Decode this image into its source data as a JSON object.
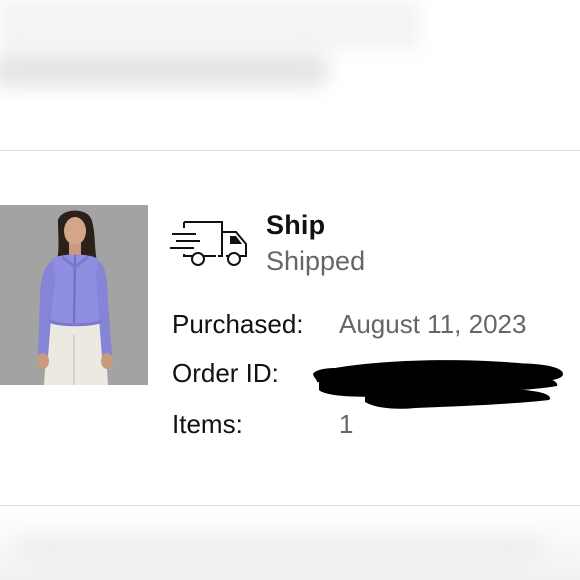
{
  "shipment": {
    "method": "Ship",
    "status": "Shipped"
  },
  "details": {
    "purchased_label": "Purchased:",
    "purchased_value": "August 11, 2023",
    "order_id_label": "Order ID:",
    "order_id_value": "",
    "items_label": "Items:",
    "items_value": "1"
  },
  "product": {
    "image_subject": "person wearing lavender cropped zip jacket and white pants"
  },
  "icons": {
    "shipping": "delivery-truck-icon"
  },
  "colors": {
    "text_primary": "#111111",
    "text_secondary": "#666666",
    "divider": "#d9d9d9",
    "jacket": "#8f8ee0",
    "redaction": "#000000"
  }
}
